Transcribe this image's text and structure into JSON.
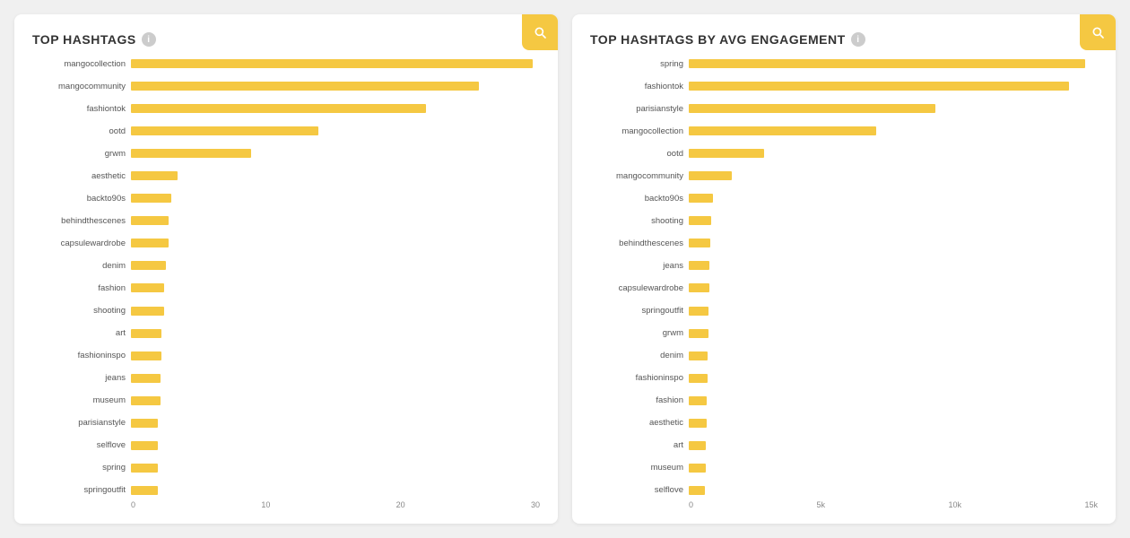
{
  "leftChart": {
    "title": "TOP HASHTAGS",
    "maxValue": 30,
    "xTicks": [
      "0",
      "10",
      "20",
      "30"
    ],
    "xTickPositions": [
      0,
      33.3,
      66.6,
      100
    ],
    "bars": [
      {
        "label": "mangocollection",
        "value": 30
      },
      {
        "label": "mangocommunity",
        "value": 26
      },
      {
        "label": "fashiontok",
        "value": 22
      },
      {
        "label": "ootd",
        "value": 14
      },
      {
        "label": "grwm",
        "value": 9
      },
      {
        "label": "aesthetic",
        "value": 3.5
      },
      {
        "label": "backto90s",
        "value": 3
      },
      {
        "label": "behindthescenes",
        "value": 2.8
      },
      {
        "label": "capsulewardrobe",
        "value": 2.8
      },
      {
        "label": "denim",
        "value": 2.6
      },
      {
        "label": "fashion",
        "value": 2.5
      },
      {
        "label": "shooting",
        "value": 2.5
      },
      {
        "label": "art",
        "value": 2.3
      },
      {
        "label": "fashioninspo",
        "value": 2.3
      },
      {
        "label": "jeans",
        "value": 2.2
      },
      {
        "label": "museum",
        "value": 2.2
      },
      {
        "label": "parisianstyle",
        "value": 2.0
      },
      {
        "label": "selflove",
        "value": 2.0
      },
      {
        "label": "spring",
        "value": 2.0
      },
      {
        "label": "springoutfit",
        "value": 2.0
      }
    ]
  },
  "rightChart": {
    "title": "TOP HASHTAGS BY AVG ENGAGEMENT",
    "maxValue": 15000,
    "xTicks": [
      "0",
      "5k",
      "10k",
      "15k"
    ],
    "xTickPositions": [
      0,
      33.3,
      66.6,
      100
    ],
    "bars": [
      {
        "label": "spring",
        "value": 14800
      },
      {
        "label": "fashiontok",
        "value": 14200
      },
      {
        "label": "parisianstyle",
        "value": 9200
      },
      {
        "label": "mangocollection",
        "value": 7000
      },
      {
        "label": "ootd",
        "value": 2800
      },
      {
        "label": "mangocommunity",
        "value": 1600
      },
      {
        "label": "backto90s",
        "value": 900
      },
      {
        "label": "shooting",
        "value": 850
      },
      {
        "label": "behindthescenes",
        "value": 820
      },
      {
        "label": "jeans",
        "value": 780
      },
      {
        "label": "capsulewardrobe",
        "value": 760
      },
      {
        "label": "springoutfit",
        "value": 740
      },
      {
        "label": "grwm",
        "value": 720
      },
      {
        "label": "denim",
        "value": 700
      },
      {
        "label": "fashioninspo",
        "value": 690
      },
      {
        "label": "fashion",
        "value": 680
      },
      {
        "label": "aesthetic",
        "value": 660
      },
      {
        "label": "art",
        "value": 640
      },
      {
        "label": "museum",
        "value": 620
      },
      {
        "label": "selflove",
        "value": 600
      }
    ]
  }
}
